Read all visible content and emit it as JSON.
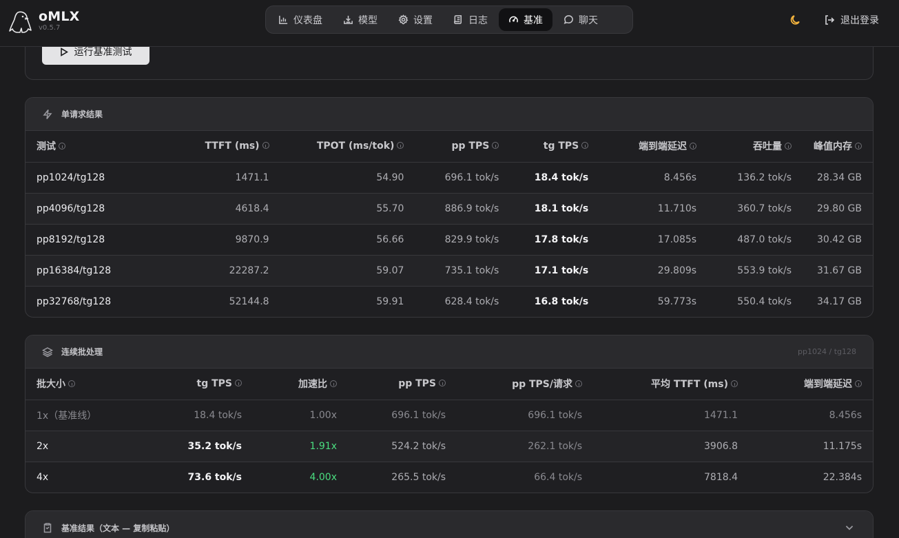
{
  "app": {
    "name": "oMLX",
    "version": "v0.5.7"
  },
  "nav": [
    {
      "label": "仪表盘",
      "icon": "bar-chart-icon"
    },
    {
      "label": "模型",
      "icon": "download-icon"
    },
    {
      "label": "设置",
      "icon": "gear-icon"
    },
    {
      "label": "日志",
      "icon": "scroll-icon"
    },
    {
      "label": "基准",
      "icon": "gauge-icon",
      "active": true
    },
    {
      "label": "聊天",
      "icon": "chat-bubble-icon"
    }
  ],
  "header": {
    "logout_label": "退出登录"
  },
  "run": {
    "label": "运行基准测试"
  },
  "single": {
    "title": "单请求结果",
    "columns": [
      "测试",
      "TTFT (ms)",
      "TPOT (ms/tok)",
      "pp TPS",
      "tg TPS",
      "端到端延迟",
      "吞吐量",
      "峰值内存"
    ],
    "rows": [
      [
        "pp1024/tg128",
        "1471.1",
        "54.90",
        "696.1 tok/s",
        "18.4 tok/s",
        "8.456s",
        "136.2 tok/s",
        "28.34 GB"
      ],
      [
        "pp4096/tg128",
        "4618.4",
        "55.70",
        "886.9 tok/s",
        "18.1 tok/s",
        "11.710s",
        "360.7 tok/s",
        "29.80 GB"
      ],
      [
        "pp8192/tg128",
        "9870.9",
        "56.66",
        "829.9 tok/s",
        "17.8 tok/s",
        "17.085s",
        "487.0 tok/s",
        "30.42 GB"
      ],
      [
        "pp16384/tg128",
        "22287.2",
        "59.07",
        "735.1 tok/s",
        "17.1 tok/s",
        "29.809s",
        "553.9 tok/s",
        "31.67 GB"
      ],
      [
        "pp32768/tg128",
        "52144.8",
        "59.91",
        "628.4 tok/s",
        "16.8 tok/s",
        "59.773s",
        "550.4 tok/s",
        "34.17 GB"
      ]
    ]
  },
  "batch": {
    "title": "连续批处理",
    "subtitle": "pp1024 / tg128",
    "columns": [
      "批大小",
      "tg TPS",
      "加速比",
      "pp TPS",
      "pp TPS/请求",
      "平均 TTFT (ms)",
      "端到端延迟"
    ],
    "rows": [
      [
        "1x（基准线）",
        "18.4 tok/s",
        "1.00x",
        "696.1 tok/s",
        "696.1 tok/s",
        "1471.1",
        "8.456s"
      ],
      [
        "2x",
        "35.2 tok/s",
        "1.91x",
        "524.2 tok/s",
        "262.1 tok/s",
        "3906.8",
        "11.175s"
      ],
      [
        "4x",
        "73.6 tok/s",
        "4.00x",
        "265.5 tok/s",
        "66.4 tok/s",
        "7818.4",
        "22.384s"
      ]
    ]
  },
  "text_results": {
    "title": "基准结果（文本 — 复制粘贴）"
  },
  "colors": {
    "accent_green": "#4ade80",
    "moon": "#f3b33d",
    "bg": "#1c1c1e",
    "card_head": "#2a2a2d"
  }
}
